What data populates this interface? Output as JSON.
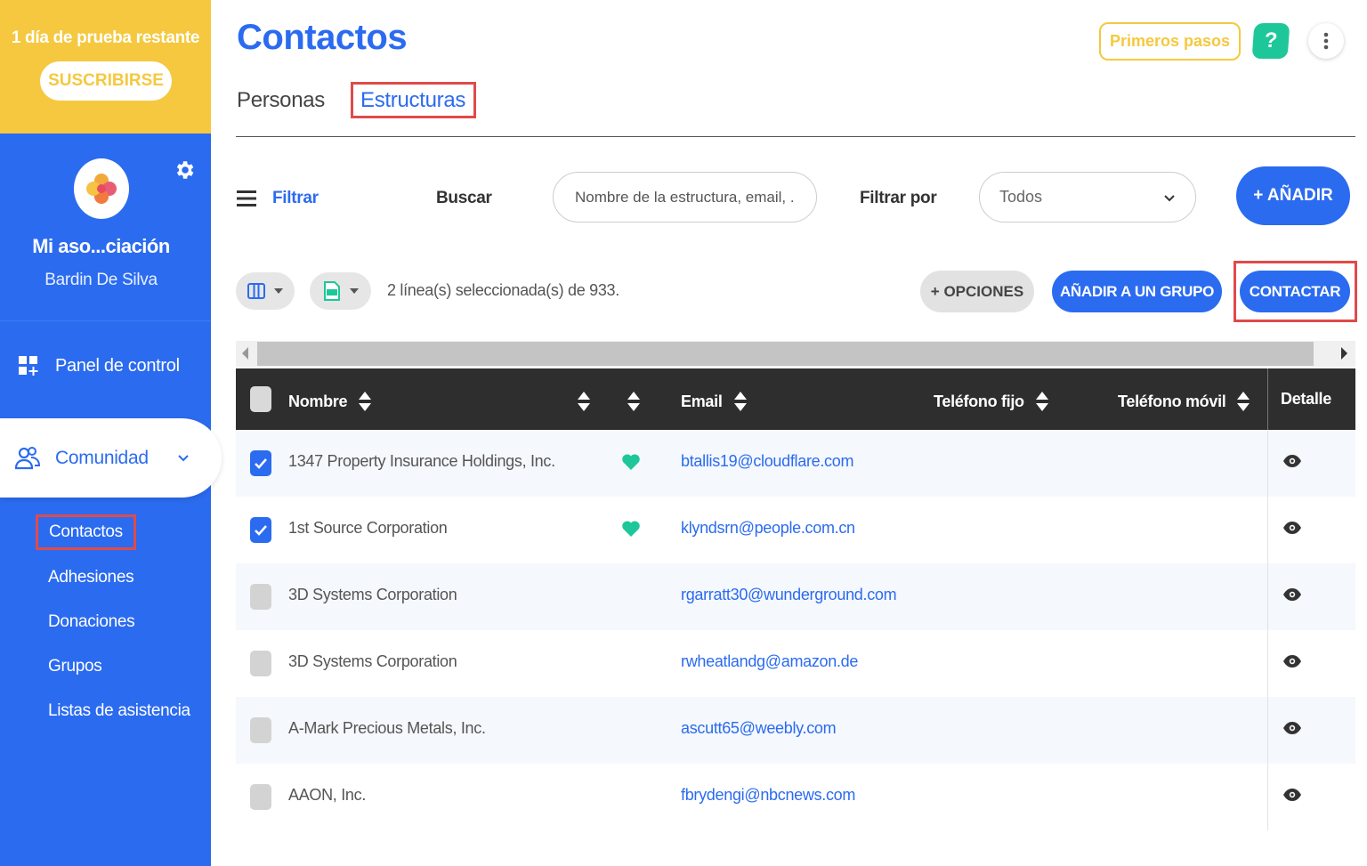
{
  "trial": {
    "text": "1 día de prueba restante",
    "subscribe_label": "SUSCRIBIRSE"
  },
  "profile": {
    "org_name": "Mi aso...ciación",
    "user_name": "Bardin De Silva"
  },
  "sidebar": {
    "panel_label": "Panel de control",
    "comunidad_label": "Comunidad",
    "subitems": [
      "Contactos",
      "Adhesiones",
      "Donaciones",
      "Grupos",
      "Listas de asistencia"
    ]
  },
  "header": {
    "title": "Contactos",
    "primeros_label": "Primeros pasos",
    "help_label": "?",
    "tabs": [
      "Personas",
      "Estructuras"
    ]
  },
  "filters": {
    "filtrar_label": "Filtrar",
    "buscar_label": "Buscar",
    "search_placeholder": "Nombre de la estructura, email, ...",
    "filtrar_por_label": "Filtrar por",
    "select_value": "Todos",
    "add_label": "+ AÑADIR"
  },
  "toolbar": {
    "selection_info": "2 línea(s) seleccionada(s) de 933.",
    "opciones_label": "+ OPCIONES",
    "grupo_label": "AÑADIR A UN GRUPO",
    "contactar_label": "CONTACTAR"
  },
  "table": {
    "columns": {
      "nombre": "Nombre",
      "email": "Email",
      "fijo": "Teléfono fijo",
      "movil": "Teléfono móvil",
      "detalle": "Detalle"
    },
    "rows": [
      {
        "name": "1347 Property Insurance Holdings, Inc.",
        "email": "btallis19@cloudflare.com",
        "checked": true,
        "fav": true
      },
      {
        "name": "1st Source Corporation",
        "email": "klyndsrn@people.com.cn",
        "checked": true,
        "fav": true
      },
      {
        "name": "3D Systems Corporation",
        "email": "rgarratt30@wunderground.com",
        "checked": false,
        "fav": false
      },
      {
        "name": "3D Systems Corporation",
        "email": "rwheatlandg@amazon.de",
        "checked": false,
        "fav": false
      },
      {
        "name": "A-Mark Precious Metals, Inc.",
        "email": "ascutt65@weebly.com",
        "checked": false,
        "fav": false
      },
      {
        "name": "AAON, Inc.",
        "email": "fbrydengi@nbcnews.com",
        "checked": false,
        "fav": false
      }
    ]
  },
  "colors": {
    "primary": "#2b6bf0",
    "trial_yellow": "#f5c83f",
    "help_green": "#1ec79a",
    "highlight_red": "#e04a4a",
    "fav_teal": "#1ec79a"
  }
}
